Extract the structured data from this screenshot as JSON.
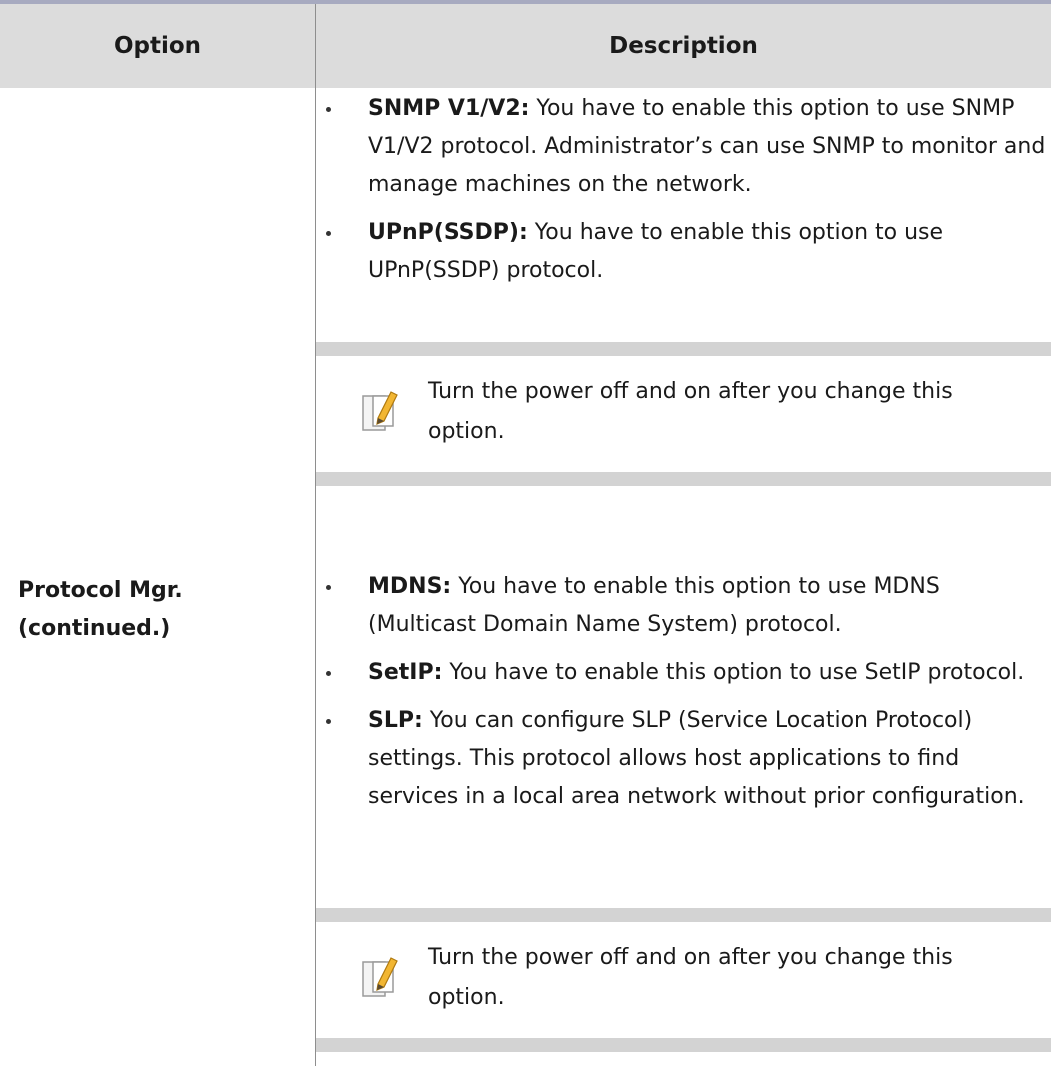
{
  "table": {
    "headers": {
      "option": "Option",
      "description": "Description"
    },
    "option_label": {
      "line1": "Protocol Mgr.",
      "line2": "(continued.)"
    },
    "bullets_group_1": [
      {
        "term": "SNMP V1/V2:",
        "text": " You have to enable this option to use SNMP V1/V2 protocol. Administrator’s can use SNMP to monitor and manage machines on the network."
      },
      {
        "term": "UPnP(SSDP):",
        "text": " You have to enable this option to use UPnP(SSDP) protocol."
      }
    ],
    "note_1": {
      "icon": "note-pencil-icon",
      "text": "Turn the power off and on after you change this option."
    },
    "bullets_group_2": [
      {
        "term": "MDNS:",
        "text": " You have to enable this option to use MDNS (Multicast Domain Name System) protocol."
      },
      {
        "term": "SetIP:",
        "text": " You have to enable this option to use SetIP protocol."
      },
      {
        "term": "SLP:",
        "text": " You can configure SLP (Service Location Protocol) settings. This protocol allows host applications to find services in a local area network without prior configuration."
      }
    ],
    "note_2": {
      "icon": "note-pencil-icon",
      "text": "Turn the power off and on after you change this option."
    }
  },
  "colors": {
    "header_background": "#dcdcdc",
    "top_rule": "#a7aac0",
    "note_bar": "#d3d3d3",
    "pencil_accent": "#f2b632"
  }
}
